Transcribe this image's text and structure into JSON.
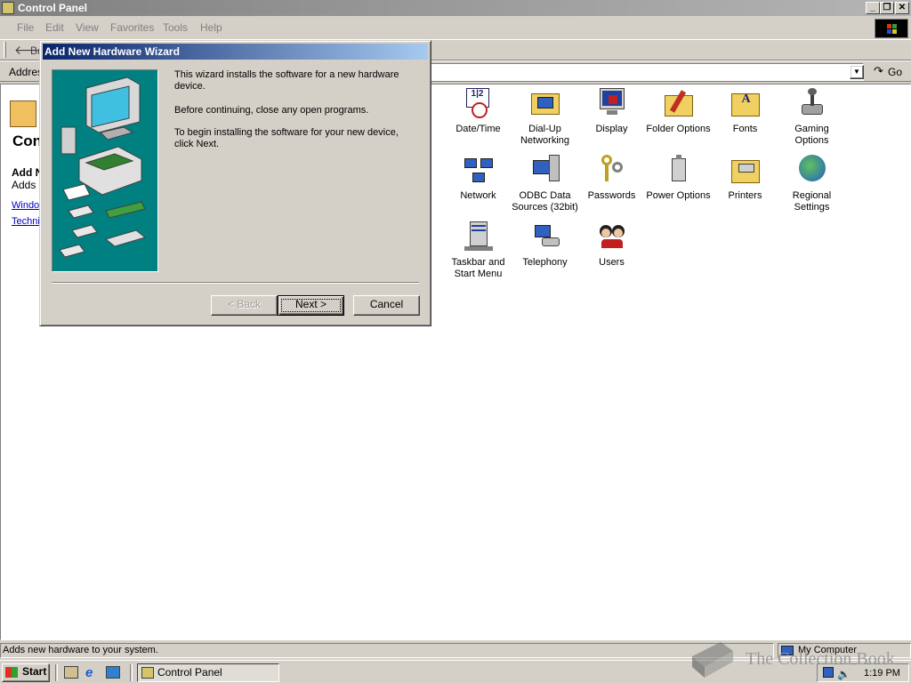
{
  "window": {
    "title": "Control Panel"
  },
  "menu": {
    "file": "File",
    "edit": "Edit",
    "view": "View",
    "favorites": "Favorites",
    "tools": "Tools",
    "help": "Help"
  },
  "toolbar": {
    "back_label": "Ba"
  },
  "address": {
    "label": "Address",
    "go_label": "Go"
  },
  "left_panel": {
    "title": "Con",
    "heading": "Add N",
    "desc": "Adds n",
    "link1": "Windo",
    "link2": "Techni"
  },
  "icons": [
    {
      "label": "Date/Time",
      "icon": "clock-calendar-icon"
    },
    {
      "label": "Dial-Up Networking",
      "icon": "dialup-networking-icon"
    },
    {
      "label": "Display",
      "icon": "display-icon"
    },
    {
      "label": "Folder Options",
      "icon": "folder-options-icon"
    },
    {
      "label": "Fonts",
      "icon": "fonts-folder-icon"
    },
    {
      "label": "Gaming Options",
      "icon": "joystick-icon"
    },
    {
      "label": "Network",
      "icon": "network-icon"
    },
    {
      "label": "ODBC Data Sources (32bit)",
      "icon": "odbc-icon"
    },
    {
      "label": "Passwords",
      "icon": "keys-icon"
    },
    {
      "label": "Power Options",
      "icon": "power-icon"
    },
    {
      "label": "Printers",
      "icon": "printers-folder-icon"
    },
    {
      "label": "Regional Settings",
      "icon": "globe-icon"
    },
    {
      "label": "Taskbar and Start Menu",
      "icon": "taskbar-icon"
    },
    {
      "label": "Telephony",
      "icon": "telephone-icon"
    },
    {
      "label": "Users",
      "icon": "users-icon"
    }
  ],
  "dialog": {
    "title": "Add New Hardware Wizard",
    "para1": "This wizard installs the software for a new hardware device.",
    "para2": "Before continuing, close any open programs.",
    "para3": "To begin installing the software for your new device, click Next.",
    "back_button": "< Back",
    "next_button": "Next >",
    "cancel_button": "Cancel"
  },
  "status": {
    "text": "Adds new hardware to your system.",
    "zone": "My Computer"
  },
  "taskbar": {
    "start": "Start",
    "task_control_panel": "Control Panel",
    "clock": "1:19 PM"
  },
  "watermark": {
    "text": "The Collection Book"
  },
  "colors": {
    "title_active": "#0a246a",
    "title_inactive": "#808080",
    "face": "#d4d0c8",
    "teal": "#008080"
  }
}
